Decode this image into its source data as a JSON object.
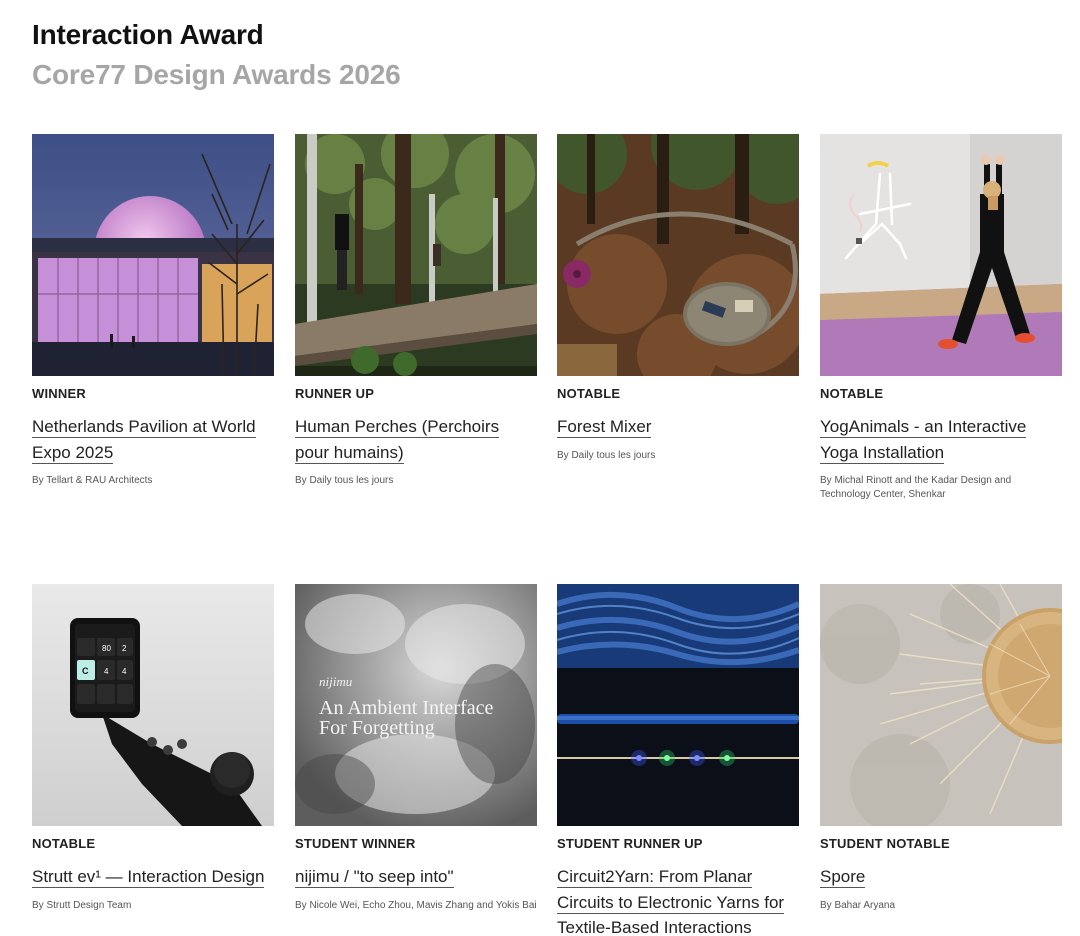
{
  "header": {
    "title": "Interaction Award",
    "subtitle": "Core77 Design Awards 2026"
  },
  "projects": [
    {
      "badge": "WINNER",
      "title": "Netherlands Pavilion at World Expo 2025",
      "credit": "By Tellart & RAU Architects"
    },
    {
      "badge": "RUNNER UP",
      "title": "Human Perches (Perchoirs pour humains)",
      "credit": "By Daily tous les jours"
    },
    {
      "badge": "NOTABLE",
      "title": "Forest Mixer",
      "credit": "By Daily tous les jours"
    },
    {
      "badge": "NOTABLE",
      "title": "YogAnimals - an Interactive Yoga Installation",
      "credit": "By Michal Rinott and the Kadar Design and Technology Center, Shenkar"
    },
    {
      "badge": "NOTABLE",
      "title": "Strutt ev¹ — Interaction Design",
      "credit": "By Strutt Design Team"
    },
    {
      "badge": "STUDENT WINNER",
      "title": "nijimu / \"to seep into\"",
      "credit": "By Nicole Wei, Echo Zhou, Mavis Zhang and Yokis Bai"
    },
    {
      "badge": "STUDENT RUNNER UP",
      "title": "Circuit2Yarn: From Planar Circuits to Electronic Yarns for Textile-Based Interactions",
      "credit": ""
    },
    {
      "badge": "STUDENT NOTABLE",
      "title": "Spore",
      "credit": "By Bahar Aryana"
    }
  ],
  "image_text": {
    "device_readout_1": "80",
    "device_readout_2": "2",
    "device_readout_3": "4",
    "device_readout_4": "4",
    "device_mode": "C",
    "nijimu_label": "nijimu",
    "nijimu_line1": "An Ambient Interface",
    "nijimu_line2": "For Forgetting"
  }
}
